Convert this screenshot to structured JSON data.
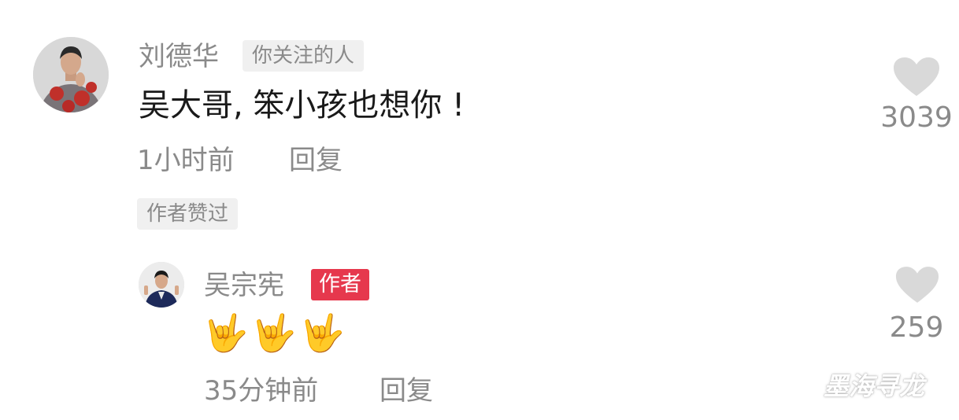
{
  "comment": {
    "username": "刘德华",
    "badge": "你关注的人",
    "text": "吴大哥, 笨小孩也想你 !",
    "time": "1小时前",
    "reply_label": "回复",
    "author_liked_badge": "作者赞过",
    "like_count": "3039",
    "avatar_icon": "user-avatar-icon",
    "heart_icon": "heart-icon"
  },
  "reply": {
    "username": "吴宗宪",
    "badge": "作者",
    "text": "🤟🤟🤟",
    "time": "35分钟前",
    "reply_label": "回复",
    "like_count": "259",
    "avatar_icon": "user-avatar-icon",
    "heart_icon": "heart-icon"
  },
  "watermark": "墨海寻龙",
  "colors": {
    "author_badge": "#e6384d",
    "muted_text": "#8a8a8a",
    "heart": "#d9d9d9"
  }
}
